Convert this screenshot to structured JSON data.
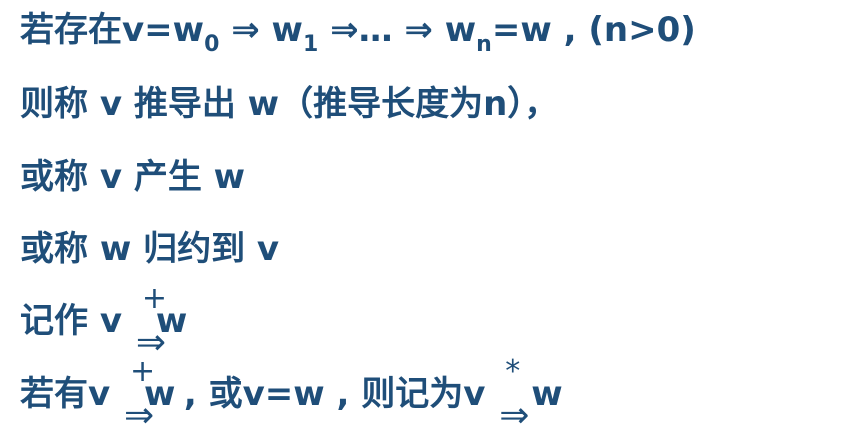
{
  "lines": {
    "l1": {
      "a": "若存在v=w",
      "s0": "0",
      "b": " ⇒ w",
      "s1": "1",
      "c": " ⇒… ⇒ w",
      "sn": "n",
      "d": "=w , (n>0)"
    },
    "l2": "则称 v 推导出 w（推导长度为n），",
    "l3": "或称 v 产生 w",
    "l4": "或称 w 归约到 v",
    "l5": {
      "a": "记作 v ",
      "plus": "+",
      "imp": "⇒",
      "w": "w"
    },
    "l6": {
      "a": "若有v ",
      "plus": "+",
      "imp": "⇒",
      "w": "w",
      "b": " , 或v=w , 则记为v ",
      "star": "*",
      "w2": "w"
    }
  },
  "colors": {
    "text": "#1f4e79"
  }
}
